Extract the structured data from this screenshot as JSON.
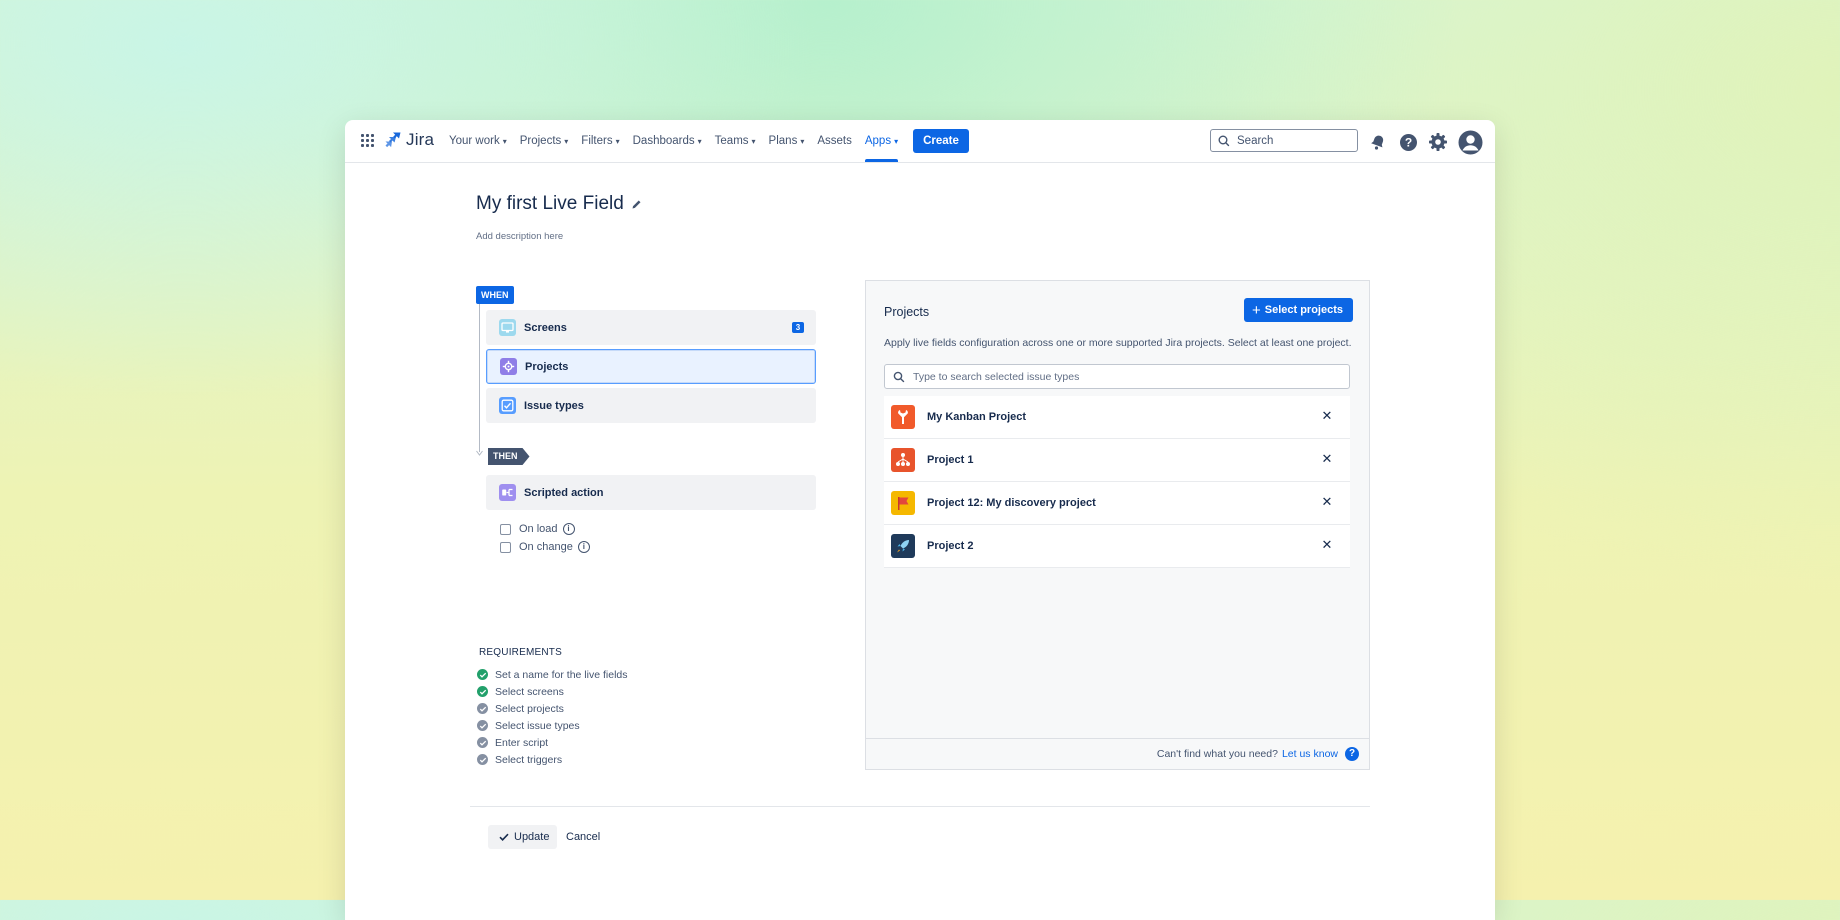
{
  "app": {
    "name": "Jira"
  },
  "nav": {
    "items": [
      {
        "label": "Your work",
        "dropdown": true,
        "active": false
      },
      {
        "label": "Projects",
        "dropdown": true,
        "active": false
      },
      {
        "label": "Filters",
        "dropdown": true,
        "active": false
      },
      {
        "label": "Dashboards",
        "dropdown": true,
        "active": false
      },
      {
        "label": "Teams",
        "dropdown": true,
        "active": false
      },
      {
        "label": "Plans",
        "dropdown": true,
        "active": false
      },
      {
        "label": "Assets",
        "dropdown": false,
        "active": false
      },
      {
        "label": "Apps",
        "dropdown": true,
        "active": true
      }
    ],
    "create_label": "Create",
    "search_placeholder": "Search",
    "icons": [
      "notifications-icon",
      "help-icon",
      "settings-icon",
      "profile-avatar-icon"
    ]
  },
  "page": {
    "title": "My first Live Field",
    "description_placeholder": "Add description here"
  },
  "flow": {
    "when_label": "WHEN",
    "then_label": "THEN",
    "when_steps": [
      {
        "label": "Screens",
        "icon": "screen-icon",
        "count": "3",
        "selected": false
      },
      {
        "label": "Projects",
        "icon": "projects-icon",
        "count": "",
        "selected": true
      },
      {
        "label": "Issue types",
        "icon": "issue-types-icon",
        "count": "",
        "selected": false
      }
    ],
    "then_step": {
      "label": "Scripted action",
      "icon": "scripted-action-icon"
    },
    "triggers": [
      {
        "label": "On load",
        "checked": false
      },
      {
        "label": "On change",
        "checked": false
      }
    ]
  },
  "requirements": {
    "title": "REQUIREMENTS",
    "items": [
      {
        "label": "Set a name for the live fields",
        "done": true
      },
      {
        "label": "Select screens",
        "done": true
      },
      {
        "label": "Select projects",
        "done": false
      },
      {
        "label": "Select issue types",
        "done": false
      },
      {
        "label": "Enter script",
        "done": false
      },
      {
        "label": "Select triggers",
        "done": false
      }
    ]
  },
  "projects_panel": {
    "title": "Projects",
    "select_button": "Select projects",
    "description": "Apply live fields configuration across one or more supported Jira projects. Select at least one project.",
    "search_placeholder": "Type to search selected issue types",
    "projects": [
      {
        "name": "My Kanban Project",
        "avatar": "wrench-avatar",
        "color": "#f15a2b"
      },
      {
        "name": "Project 1",
        "avatar": "network-avatar",
        "color": "#e8542c"
      },
      {
        "name": "Project 12: My discovery project",
        "avatar": "flag-avatar",
        "color": "#f5b800"
      },
      {
        "name": "Project 2",
        "avatar": "rocket-avatar",
        "color": "#1f3a5a"
      }
    ],
    "footer_text": "Can't find what you need?",
    "footer_link": "Let us know"
  },
  "actions": {
    "update_label": "Update",
    "cancel_label": "Cancel"
  },
  "colors": {
    "primary": "#0c66e4",
    "success": "#22a06b",
    "pending": "#8590a2"
  }
}
